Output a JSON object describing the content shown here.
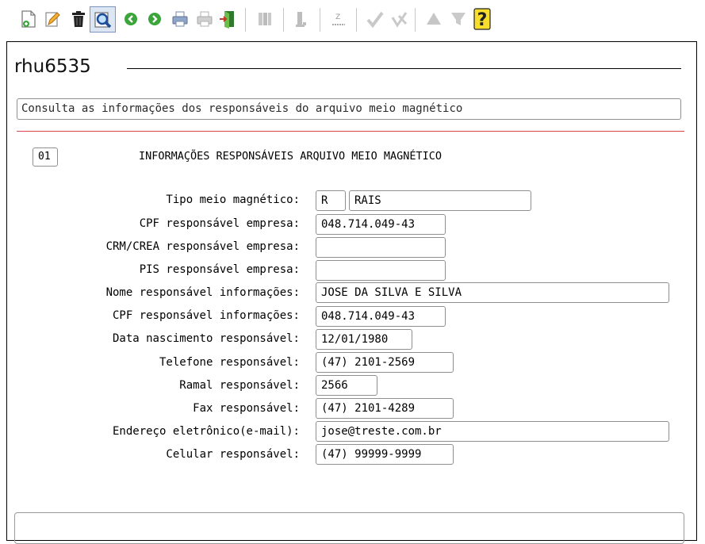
{
  "toolbar": {
    "buttons": [
      "new-doc-icon",
      "edit-pencil-icon",
      "trash-icon",
      "search-magnifier-icon",
      "back-arrow-icon",
      "forward-arrow-icon",
      "print-icon",
      "print-disabled-icon",
      "exit-door-icon",
      "first-record-icon",
      "previous-record-icon",
      "next-record-icon",
      "confirm-check-icon",
      "cancel-x-icon",
      "up-triangle-icon",
      "filter-icon",
      "help-question-icon"
    ],
    "help_glyph": "?"
  },
  "program": {
    "title": "rhu6535",
    "description": "Consulta as informações dos responsáveis do arquivo meio magnético"
  },
  "section": {
    "code": "01",
    "heading": "INFORMAÇÕES RESPONSÁVEIS ARQUIVO MEIO MAGNÉTICO"
  },
  "form": {
    "tipo_label": "Tipo meio magnético:",
    "tipo_code": "R",
    "tipo_desc": "RAIS",
    "cpf_empresa_label": "CPF responsável empresa:",
    "cpf_empresa": "048.714.049-43",
    "crm_label": "CRM/CREA responsável empresa:",
    "crm": "",
    "pis_label": "PIS responsável empresa:",
    "pis": "",
    "nome_label": "Nome responsável informações:",
    "nome": "JOSE DA SILVA E SILVA",
    "cpf_info_label": "CPF responsável informações:",
    "cpf_info": "048.714.049-43",
    "nasc_label": "Data nascimento responsável:",
    "nasc": "12/01/1980",
    "tel_label": "Telefone responsável:",
    "tel": "(47) 2101-2569",
    "ramal_label": "Ramal responsável:",
    "ramal": "2566",
    "fax_label": "Fax responsável:",
    "fax": "(47) 2101-4289",
    "email_label": "Endereço eletrônico(e-mail):",
    "email": "jose@treste.com.br",
    "celular_label": "Celular responsável:",
    "celular": "(47) 99999-9999"
  }
}
